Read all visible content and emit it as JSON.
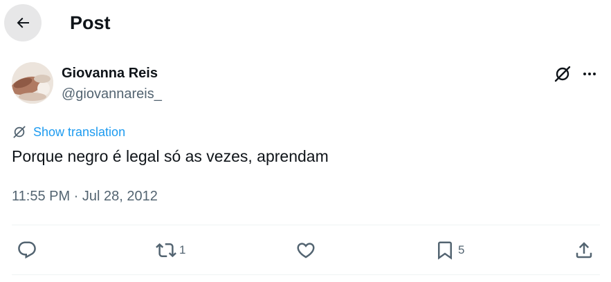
{
  "header": {
    "title": "Post",
    "back_icon": "arrow-left-icon"
  },
  "author": {
    "name": "Giovanna Reis",
    "handle": "@giovannareis_"
  },
  "post": {
    "translation_label": "Show translation",
    "text": "Porque negro é legal só as vezes, aprendam",
    "timestamp": "11:55 PM · Jul 28, 2012"
  },
  "actions": {
    "reply": {
      "icon": "reply-icon"
    },
    "repost": {
      "icon": "repost-icon",
      "count": "1"
    },
    "like": {
      "icon": "heart-icon"
    },
    "bookmark": {
      "icon": "bookmark-icon",
      "count": "5"
    },
    "share": {
      "icon": "share-icon"
    }
  },
  "colors": {
    "link": "#1d9bf0",
    "secondary_text": "#536471",
    "primary_text": "#0f1419",
    "divider": "#eff3f4"
  }
}
